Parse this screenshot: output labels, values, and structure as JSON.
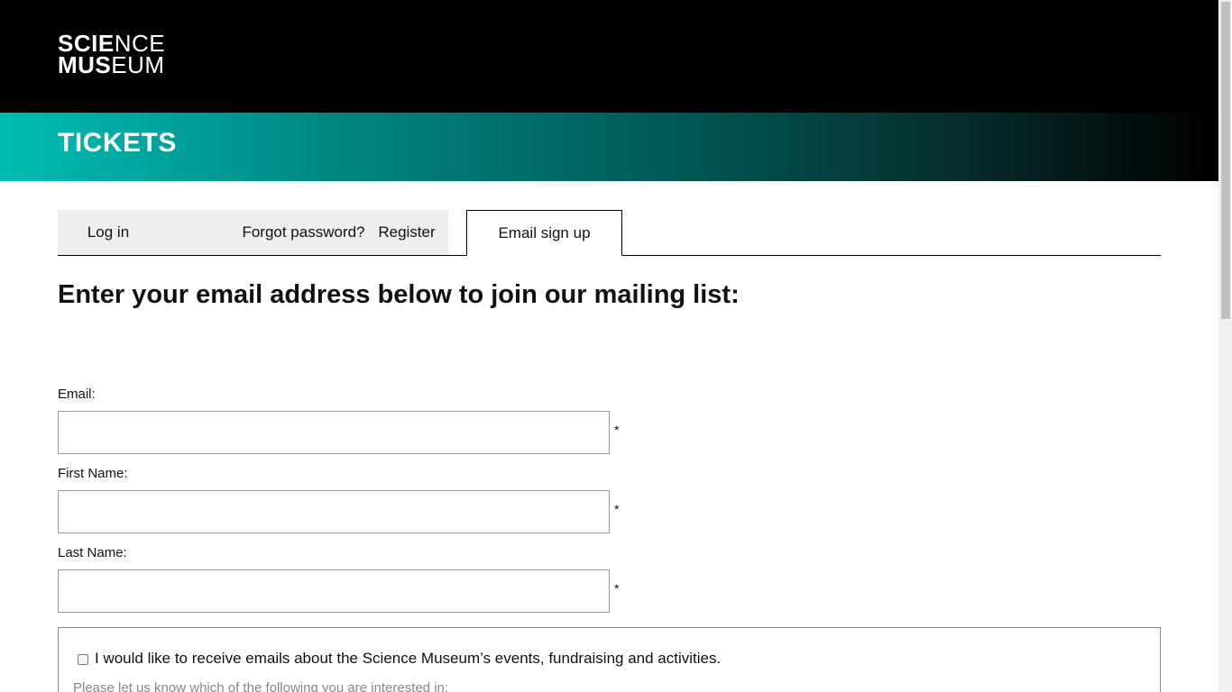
{
  "header": {
    "logo_line1_bold": "SCIE",
    "logo_line1_light": "NCE",
    "logo_line2_bold": "MUS",
    "logo_line2_light": "EUM"
  },
  "banner": {
    "title": "TICKETS"
  },
  "tabs": [
    {
      "label": "Log in"
    },
    {
      "label": "Forgot password?"
    },
    {
      "label": "Register"
    },
    {
      "label": "Email sign up"
    }
  ],
  "form": {
    "heading": "Enter your email address below to join our mailing list:",
    "fields": [
      {
        "label": "Email:",
        "value": "",
        "required_mark": "*"
      },
      {
        "label": "First Name:",
        "value": "",
        "required_mark": "*"
      },
      {
        "label": "Last Name:",
        "value": "",
        "required_mark": "*"
      }
    ],
    "consent": {
      "text": "I would like to receive emails about the Science Museum’s events, fundraising and activities.",
      "checked": false,
      "sub_text": "Please let us know which of the following you are interested in:"
    }
  },
  "colors": {
    "header_bg": "#000000",
    "banner_start": "#00bdb4",
    "banner_end": "#000000",
    "tab_bg": "#eeeeee"
  }
}
